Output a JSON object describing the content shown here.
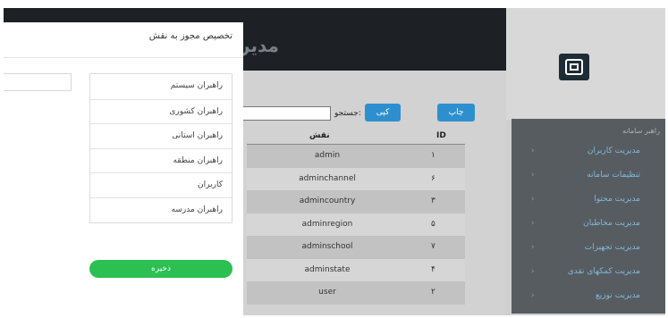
{
  "header": {
    "title_fragment": "مدیر"
  },
  "logo": {
    "icon": "brand-logo-icon"
  },
  "sidebar": {
    "heading": "راهبر سامانه",
    "items": [
      {
        "label": "مدیریت کاربران"
      },
      {
        "label": "تنظیمات سامانه"
      },
      {
        "label": "مدیریت محتوا"
      },
      {
        "label": "مدیریت مخاطبان"
      },
      {
        "label": "مدیریت تجهیزات"
      },
      {
        "label": "مدیریت کمکهای نقدی"
      },
      {
        "label": "مدیریت توزیع"
      }
    ],
    "chevron": "›"
  },
  "toolbar": {
    "print_label": "چاپ",
    "copy_label": "کپی",
    "search_label": "جستجو:"
  },
  "table": {
    "columns": {
      "role": "نقش",
      "id": "ID"
    },
    "rows": [
      {
        "role": "admin",
        "id": "۱"
      },
      {
        "role": "adminchannel",
        "id": "۶"
      },
      {
        "role": "admincountry",
        "id": "۳"
      },
      {
        "role": "adminregion",
        "id": "۵"
      },
      {
        "role": "adminschool",
        "id": "۷"
      },
      {
        "role": "adminstate",
        "id": "۴"
      },
      {
        "role": "user",
        "id": "۲"
      }
    ]
  },
  "modal": {
    "title": "تخصیص مجوز به نقش",
    "roles": [
      {
        "label": "راهبران سیستم"
      },
      {
        "label": "راهبران کشوری"
      },
      {
        "label": "راهبران استانی"
      },
      {
        "label": "راهبران منطقه"
      },
      {
        "label": "کاربران"
      },
      {
        "label": "راهبران مدرسه"
      }
    ],
    "save_label": "ذخیره"
  },
  "colors": {
    "topbar": "#1d2126",
    "accent_blue": "#2e8fcf",
    "save_green": "#2cbf52",
    "sidebar_link": "#5fb3dd"
  }
}
